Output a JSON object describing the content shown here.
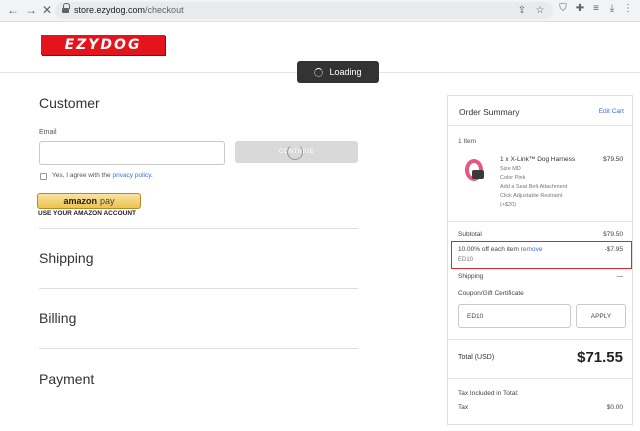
{
  "browser": {
    "url_host": "store.ezydog.com",
    "url_path": "/checkout",
    "icons": [
      "back-icon",
      "forward-icon",
      "stop-icon",
      "lock-icon",
      "share-icon",
      "star-icon",
      "shield-icon",
      "extensions-icon",
      "reading-list-icon",
      "download-icon",
      "profile-icon",
      "menu-icon"
    ]
  },
  "header": {
    "logo_text": "EZYDOG",
    "loading_text": "Loading"
  },
  "checkout": {
    "customer_title": "Customer",
    "email_label": "Email",
    "email_value": "",
    "continue_label": "CONTINUE",
    "privacy_text": "Yes, I agree with the ",
    "privacy_link": "privacy policy",
    "privacy_suffix": ".",
    "amazon_brand": "amazon",
    "amazon_pay": "pay",
    "amazon_caption": "USE YOUR AMAZON ACCOUNT",
    "shipping_title": "Shipping",
    "billing_title": "Billing",
    "payment_title": "Payment"
  },
  "summary": {
    "title": "Order Summary",
    "edit_cart": "Edit Cart",
    "items_count": "1 Item",
    "product": {
      "name": "1 x X-Link™ Dog Harness",
      "price": "$79.50",
      "options": [
        "Size MD",
        "Color Pink",
        "Add a Seat Belt Attachment",
        "Click Adjustable Restraint",
        "(+$20)"
      ]
    },
    "subtotal_label": "Subtotal",
    "subtotal_value": "$79.50",
    "discount_label": "10.00% off each item ",
    "discount_remove": "remove",
    "discount_value": "-$7.95",
    "discount_code": "ED10",
    "shipping_label": "Shipping",
    "shipping_value": "—",
    "coupon_label": "Coupon/Gift Certificate",
    "coupon_value": "ED10",
    "apply_label": "APPLY",
    "total_label": "Total (USD)",
    "total_value": "$71.55",
    "tax_included_label": "Tax Included in Total:",
    "tax_label": "Tax",
    "tax_value": "$0.00"
  },
  "colors": {
    "brand_red": "#e3141c",
    "link_blue": "#3a6fd8",
    "highlight_red": "#e0262b"
  }
}
